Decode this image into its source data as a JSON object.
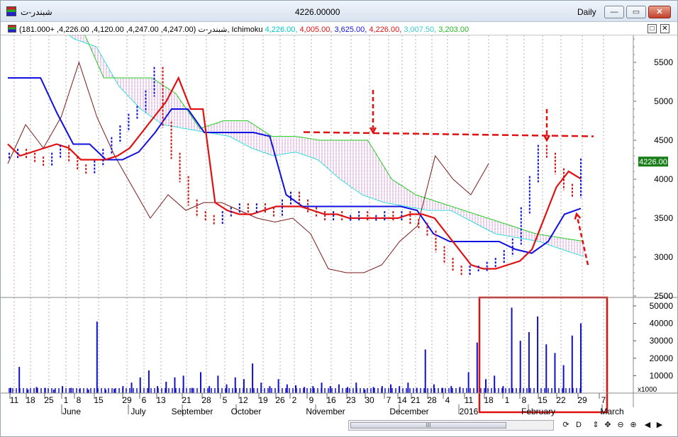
{
  "window": {
    "symbol": "شبندر-ت",
    "price_display": "4226.00000",
    "timeframe": "Daily",
    "minimize_label": "—",
    "restore_label": "▭",
    "close_label": "✕"
  },
  "legend": {
    "symbol": "شبندر-ت",
    "ohlc_text": "(4,247.00, 4,247.00, 4,120.00, 4,226.00, +181.000),",
    "indicator_name": "Ichimoku",
    "values": [
      {
        "text": "4,226.00,",
        "color": "#00c8c8"
      },
      {
        "text": "4,005.00,",
        "color": "#dd1111"
      },
      {
        "text": "3,625.00,",
        "color": "#1111dd"
      },
      {
        "text": "4,226.00,",
        "color": "#dd1111"
      },
      {
        "text": "3,007.50,",
        "color": "#33cccc"
      },
      {
        "text": "3,203.00",
        "color": "#22bb22"
      }
    ],
    "restore_label": "□",
    "close_label": "✕"
  },
  "price_axis": {
    "labels": [
      "5500",
      "5000",
      "4500",
      "4000",
      "3500",
      "3000",
      "2500"
    ],
    "last_price": "4226.00"
  },
  "volume_axis": {
    "labels": [
      "50000",
      "40000",
      "30000",
      "20000",
      "10000"
    ],
    "multiplier": "x1000"
  },
  "x_axis": {
    "day_labels": [
      "11",
      "18",
      "25",
      "1",
      "8",
      "15",
      "29",
      "6",
      "13",
      "21",
      "28",
      "5",
      "12",
      "19",
      "26",
      "2",
      "9",
      "16",
      "23",
      "30",
      "7",
      "14",
      "21",
      "28",
      "4",
      "11",
      "18",
      "1",
      "8",
      "15",
      "22",
      "29",
      "7"
    ],
    "month_labels": [
      "June",
      "July",
      "September",
      "October",
      "November",
      "December",
      "2016",
      "February",
      "March"
    ]
  },
  "chart_data": {
    "type": "line",
    "price_range": [
      2500,
      5800
    ],
    "close_series": [
      4300,
      4350,
      4300,
      4250,
      4200,
      4300,
      4400,
      4250,
      4150,
      4100,
      4200,
      4350,
      4500,
      4650,
      4800,
      4900,
      5100,
      5400,
      4700,
      4300,
      4000,
      3700,
      3550,
      3500,
      3450,
      3550,
      3600,
      3650,
      3600,
      3650,
      3600,
      3550,
      3700,
      3800,
      3700,
      3600,
      3550,
      3500,
      3550,
      3500,
      3500,
      3550,
      3500,
      3500,
      3550,
      3500,
      3550,
      3450,
      3400,
      3300,
      3100,
      2950,
      2850,
      2800,
      2850,
      2850,
      2900,
      2950,
      3050,
      3200,
      3600,
      4000,
      4400,
      4300,
      4100,
      3900,
      3800,
      4226
    ],
    "tenkan_series": [
      4450,
      4300,
      4350,
      4400,
      4450,
      4400,
      4250,
      4250,
      4250,
      4300,
      4400,
      4600,
      4800,
      5000,
      5300,
      4900,
      4900,
      3700,
      3600,
      3550,
      3550,
      3600,
      3650,
      3650,
      3650,
      3600,
      3550,
      3550,
      3500,
      3500,
      3500,
      3500,
      3500,
      3550,
      3550,
      3500,
      3300,
      3100,
      2900,
      2850,
      2850,
      2900,
      2950,
      3100,
      3500,
      3900,
      4100,
      4005
    ],
    "kijun_series": [
      5300,
      5300,
      5300,
      4850,
      4450,
      4450,
      4250,
      4250,
      4350,
      4600,
      4900,
      4900,
      4600,
      4600,
      4600,
      4600,
      4550,
      3800,
      3650,
      3650,
      3650,
      3650,
      3650,
      3650,
      3650,
      3600,
      3300,
      3200,
      3200,
      3200,
      3200,
      3100,
      3050,
      3200,
      3550,
      3625
    ],
    "chikou_series": [
      4200,
      4700,
      4400,
      4800,
      5500,
      4800,
      4300,
      3900,
      3500,
      3800,
      3600,
      3700,
      3700,
      3600,
      3500,
      3450,
      3500,
      3300,
      2850,
      2800,
      2800,
      2900,
      3200,
      3400,
      4300,
      4000,
      3800,
      4200
    ],
    "span_a_series": [
      6000,
      6000,
      6000,
      5800,
      5700,
      5200,
      4900,
      4700,
      4650,
      4600,
      4550,
      4400,
      4300,
      4350,
      4250,
      4000,
      3800,
      3700,
      3650,
      3600,
      3600,
      3450,
      3300,
      3250,
      3200,
      3100,
      3007.5
    ],
    "span_b_series": [
      6000,
      6000,
      6000,
      6000,
      5300,
      5300,
      5300,
      5100,
      4650,
      4750,
      4750,
      4550,
      4550,
      4500,
      4500,
      4500,
      4000,
      3800,
      3700,
      3600,
      3500,
      3400,
      3300,
      3250,
      3203
    ],
    "volume_series": [
      3000,
      15000,
      2000,
      3500,
      3000,
      2000,
      4000,
      3000,
      2500,
      2000,
      41000,
      2000,
      2500,
      4000,
      6000,
      9000,
      13000,
      4000,
      6500,
      9000,
      10000,
      3000,
      12000,
      4000,
      10000,
      5000,
      9000,
      8000,
      17000,
      6000,
      4000,
      8000,
      5000,
      4500,
      3500,
      4000,
      6000,
      4000,
      5000,
      3500,
      6000,
      2000,
      3500,
      4000,
      5000,
      4000,
      6000,
      3000,
      25000,
      5000,
      3000,
      4000,
      3500,
      12000,
      29000,
      8000,
      10000,
      4000,
      49000,
      30000,
      35000,
      44000,
      28000,
      23000,
      16000,
      33000,
      40000
    ],
    "annotations": {
      "resistance_line_price": 4550,
      "highlight_box": "volume spike region (Jan–Feb 2016)"
    }
  },
  "toolbar": {
    "scroll_grip": "III",
    "icons": [
      "refresh-icon",
      "data-icon",
      "scroll-icon",
      "zoom-out-icon",
      "zoom-in-icon",
      "prev-icon",
      "play-icon",
      "next-icon"
    ],
    "glyphs": [
      "⟳",
      "D",
      "⇕",
      "✥",
      "⊖",
      "⊕",
      "◀",
      "▶"
    ]
  }
}
